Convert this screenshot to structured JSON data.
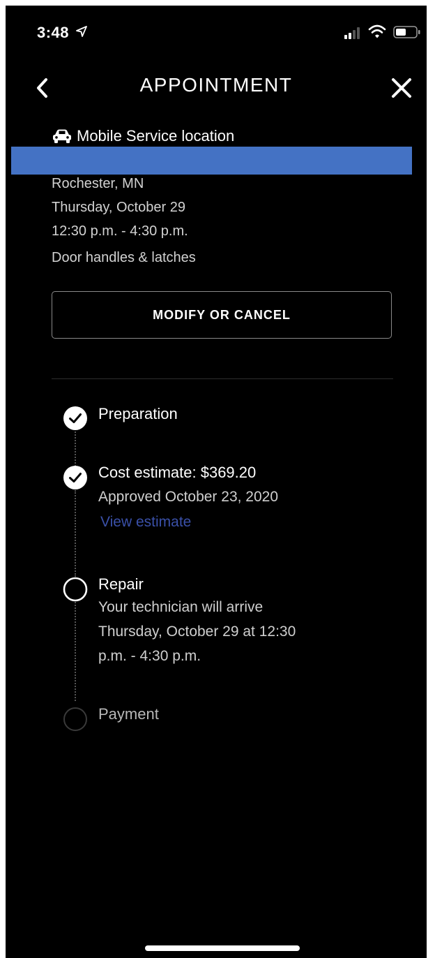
{
  "status_bar": {
    "time": "3:48",
    "icons": [
      "location-arrow-icon",
      "cellular-signal-icon",
      "wifi-icon",
      "battery-icon"
    ]
  },
  "header": {
    "title": "APPOINTMENT",
    "back_icon": "chevron-left-icon",
    "close_icon": "close-icon"
  },
  "appointment": {
    "location_type": "Mobile Service location",
    "location_icon": "car-icon",
    "city": "Rochester, MN",
    "date": "Thursday, October 29",
    "time_window": "12:30 p.m. - 4:30 p.m.",
    "service": "Door handles & latches",
    "modify_label": "MODIFY OR CANCEL"
  },
  "timeline": {
    "steps": [
      {
        "title": "Preparation",
        "status": "complete"
      },
      {
        "title": "Cost estimate: $369.20",
        "status": "complete",
        "subtitle": "Approved October 23, 2020",
        "link": "View estimate"
      },
      {
        "title": "Repair",
        "status": "current",
        "subtitle_lines": [
          "Your technician will arrive",
          "Thursday, October 29 at 12:30",
          "p.m. - 4:30 p.m."
        ]
      },
      {
        "title": "Payment",
        "status": "pending"
      }
    ]
  },
  "colors": {
    "background": "#000000",
    "text": "#ffffff",
    "secondary_text": "#cfcfcf",
    "link": "#3a50a8",
    "redaction": "#4472c4"
  }
}
